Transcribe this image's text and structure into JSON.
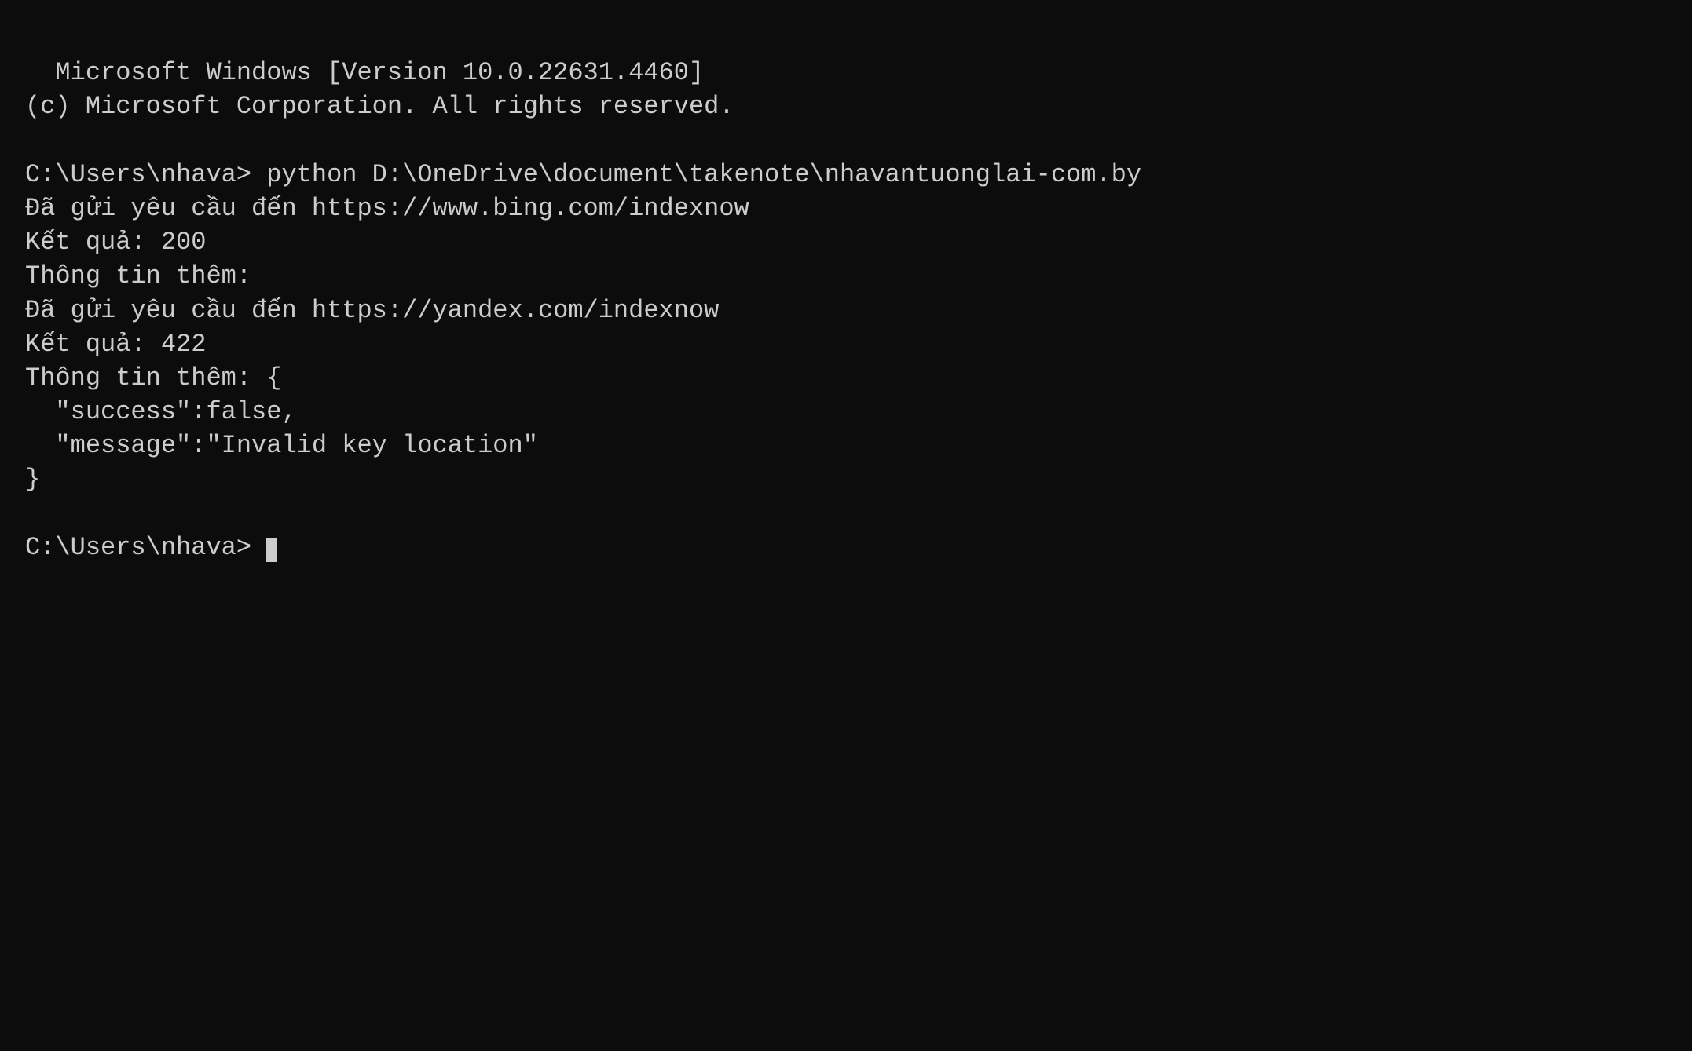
{
  "terminal": {
    "background": "#0c0c0c",
    "text_color": "#cccccc",
    "lines": [
      "Microsoft Windows [Version 10.0.22631.4460]",
      "(c) Microsoft Corporation. All rights reserved.",
      "",
      "C:\\Users\\nhava> python D:\\OneDrive\\document\\takenote\\nhavantuonglai-com.by",
      "Đã gửi yêu cầu đến https://www.bing.com/indexnow",
      "Kết quả: 200",
      "Thông tin thêm:",
      "Đã gửi yêu cầu đến https://yandex.com/indexnow",
      "Kết quả: 422",
      "Thông tin thêm: {",
      "  \"success\":false,",
      "  \"message\":\"Invalid key location\"",
      "}",
      "",
      "C:\\Users\\nhava> "
    ],
    "prompt": "C:\\Users\\nhava> "
  }
}
